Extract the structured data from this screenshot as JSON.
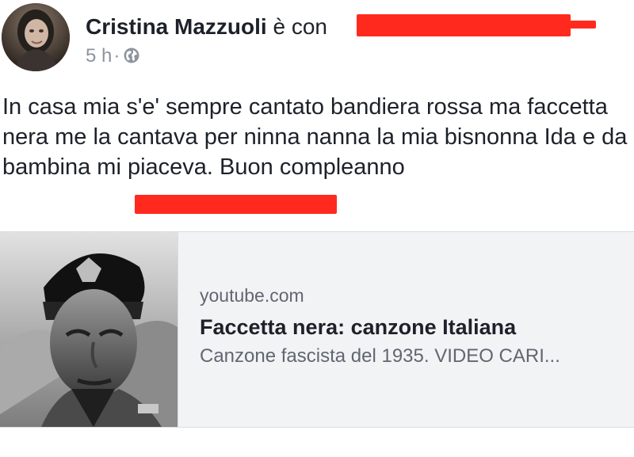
{
  "post": {
    "author": "Cristina Mazzuoli",
    "author_suffix": "è con",
    "time": "5 h",
    "separator": "·",
    "privacy_icon": "globe-icon",
    "text": "In casa mia s'e' sempre cantato bandiera rossa ma faccetta nera me la cantava per ninna nanna la mia bisnonna Ida e da bambina mi piaceva. Buon compleanno",
    "redaction_color": "#ff2a1d"
  },
  "link_preview": {
    "domain": "youtube.com",
    "title": "Faccetta nera: canzone Italiana",
    "description": "Canzone fascista del 1935. VIDEO CARI..."
  }
}
